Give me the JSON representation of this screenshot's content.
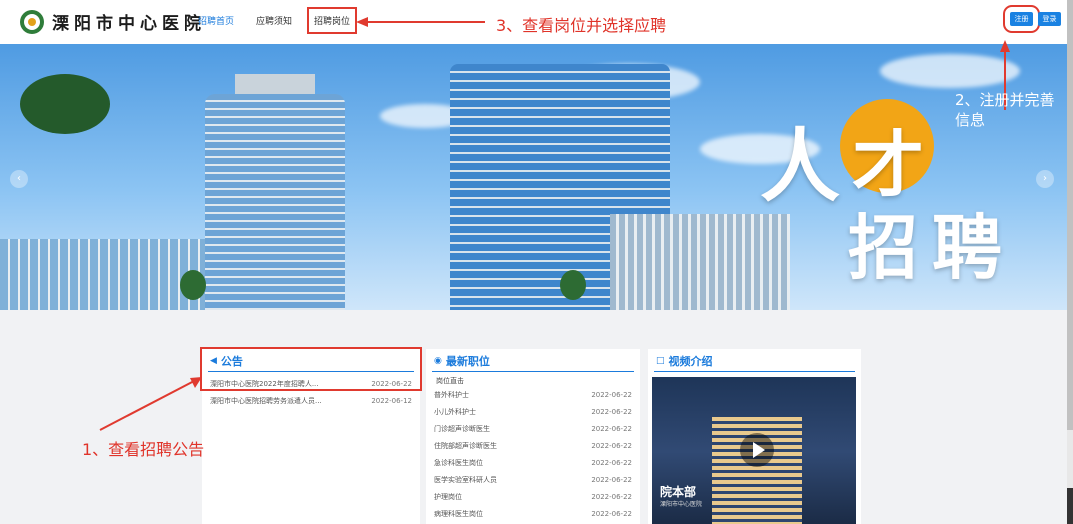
{
  "header": {
    "logo_text": "溧阳市中心医院",
    "nav": [
      "招聘首页",
      "应聘须知",
      "招聘岗位"
    ],
    "register_label": "注册",
    "login_label": "登录"
  },
  "banner": {
    "hero_ren": "人",
    "hero_cai": "才",
    "hero_zp": "招聘",
    "prev_glyph": "‹",
    "next_glyph": "›"
  },
  "annotations": {
    "step1": "1、查看招聘公告",
    "step2": "2、注册并完善信息",
    "step3": "3、查看岗位并选择应聘"
  },
  "notice": {
    "title": "公告",
    "items": [
      {
        "title": "溧阳市中心医院2022年度招聘人...",
        "date": "2022-06-22"
      },
      {
        "title": "溧阳市中心医院招聘劳务派遣人员...",
        "date": "2022-06-12"
      }
    ]
  },
  "jobs": {
    "title": "最新职位",
    "sub_title": "岗位直击",
    "items": [
      {
        "title": "普外科护士",
        "date": "2022-06-22"
      },
      {
        "title": "小儿外科护士",
        "date": "2022-06-22"
      },
      {
        "title": "门诊超声诊断医生",
        "date": "2022-06-22"
      },
      {
        "title": "住院部超声诊断医生",
        "date": "2022-06-22"
      },
      {
        "title": "急诊科医生岗位",
        "date": "2022-06-22"
      },
      {
        "title": "医学实验室科研人员",
        "date": "2022-06-22"
      },
      {
        "title": "护理岗位",
        "date": "2022-06-22"
      },
      {
        "title": "病理科医生岗位",
        "date": "2022-06-22"
      }
    ]
  },
  "video": {
    "title": "视频介绍",
    "thumb_title": "院本部",
    "thumb_sub": "溧阳市中心医院"
  },
  "colors": {
    "accent": "#1b7bdc",
    "annotation": "#e03a2f",
    "hero_orange": "#f2a516"
  }
}
